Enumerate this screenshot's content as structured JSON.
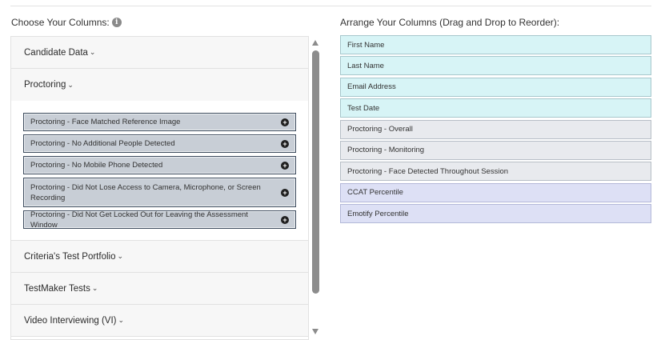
{
  "left_panel": {
    "title": "Choose Your Columns:",
    "info_icon": "info-icon",
    "sections": [
      {
        "label": "Candidate Data",
        "expanded": false
      },
      {
        "label": "Proctoring",
        "expanded": true
      },
      {
        "label": "Criteria's Test Portfolio",
        "expanded": false
      },
      {
        "label": "TestMaker Tests",
        "expanded": false
      },
      {
        "label": "Video Interviewing (VI)",
        "expanded": false
      }
    ],
    "proctoring_options": [
      "Proctoring - Face Matched Reference Image",
      "Proctoring - No Additional People Detected",
      "Proctoring - No Mobile Phone Detected",
      "Proctoring - Did Not Lose Access to Camera, Microphone, or Screen Recording",
      "Proctoring - Did Not Get Locked Out for Leaving the Assessment Window"
    ],
    "add_icon": "plus-circle-icon",
    "caret": "⌄"
  },
  "right_panel": {
    "title": "Arrange Your Columns (Drag and Drop to Reorder):",
    "columns": [
      {
        "label": "First Name",
        "color": "#d7f4f6"
      },
      {
        "label": "Last Name",
        "color": "#d7f4f6"
      },
      {
        "label": "Email Address",
        "color": "#d7f4f6"
      },
      {
        "label": "Test Date",
        "color": "#d7f4f6"
      },
      {
        "label": "Proctoring - Overall",
        "color": "#e8eaee"
      },
      {
        "label": "Proctoring - Monitoring",
        "color": "#e8eaee"
      },
      {
        "label": "Proctoring - Face Detected Throughout Session",
        "color": "#e8eaee"
      },
      {
        "label": "CCAT Percentile",
        "color": "#dde0f5"
      },
      {
        "label": "Emotify Percentile",
        "color": "#dde0f5"
      }
    ]
  }
}
